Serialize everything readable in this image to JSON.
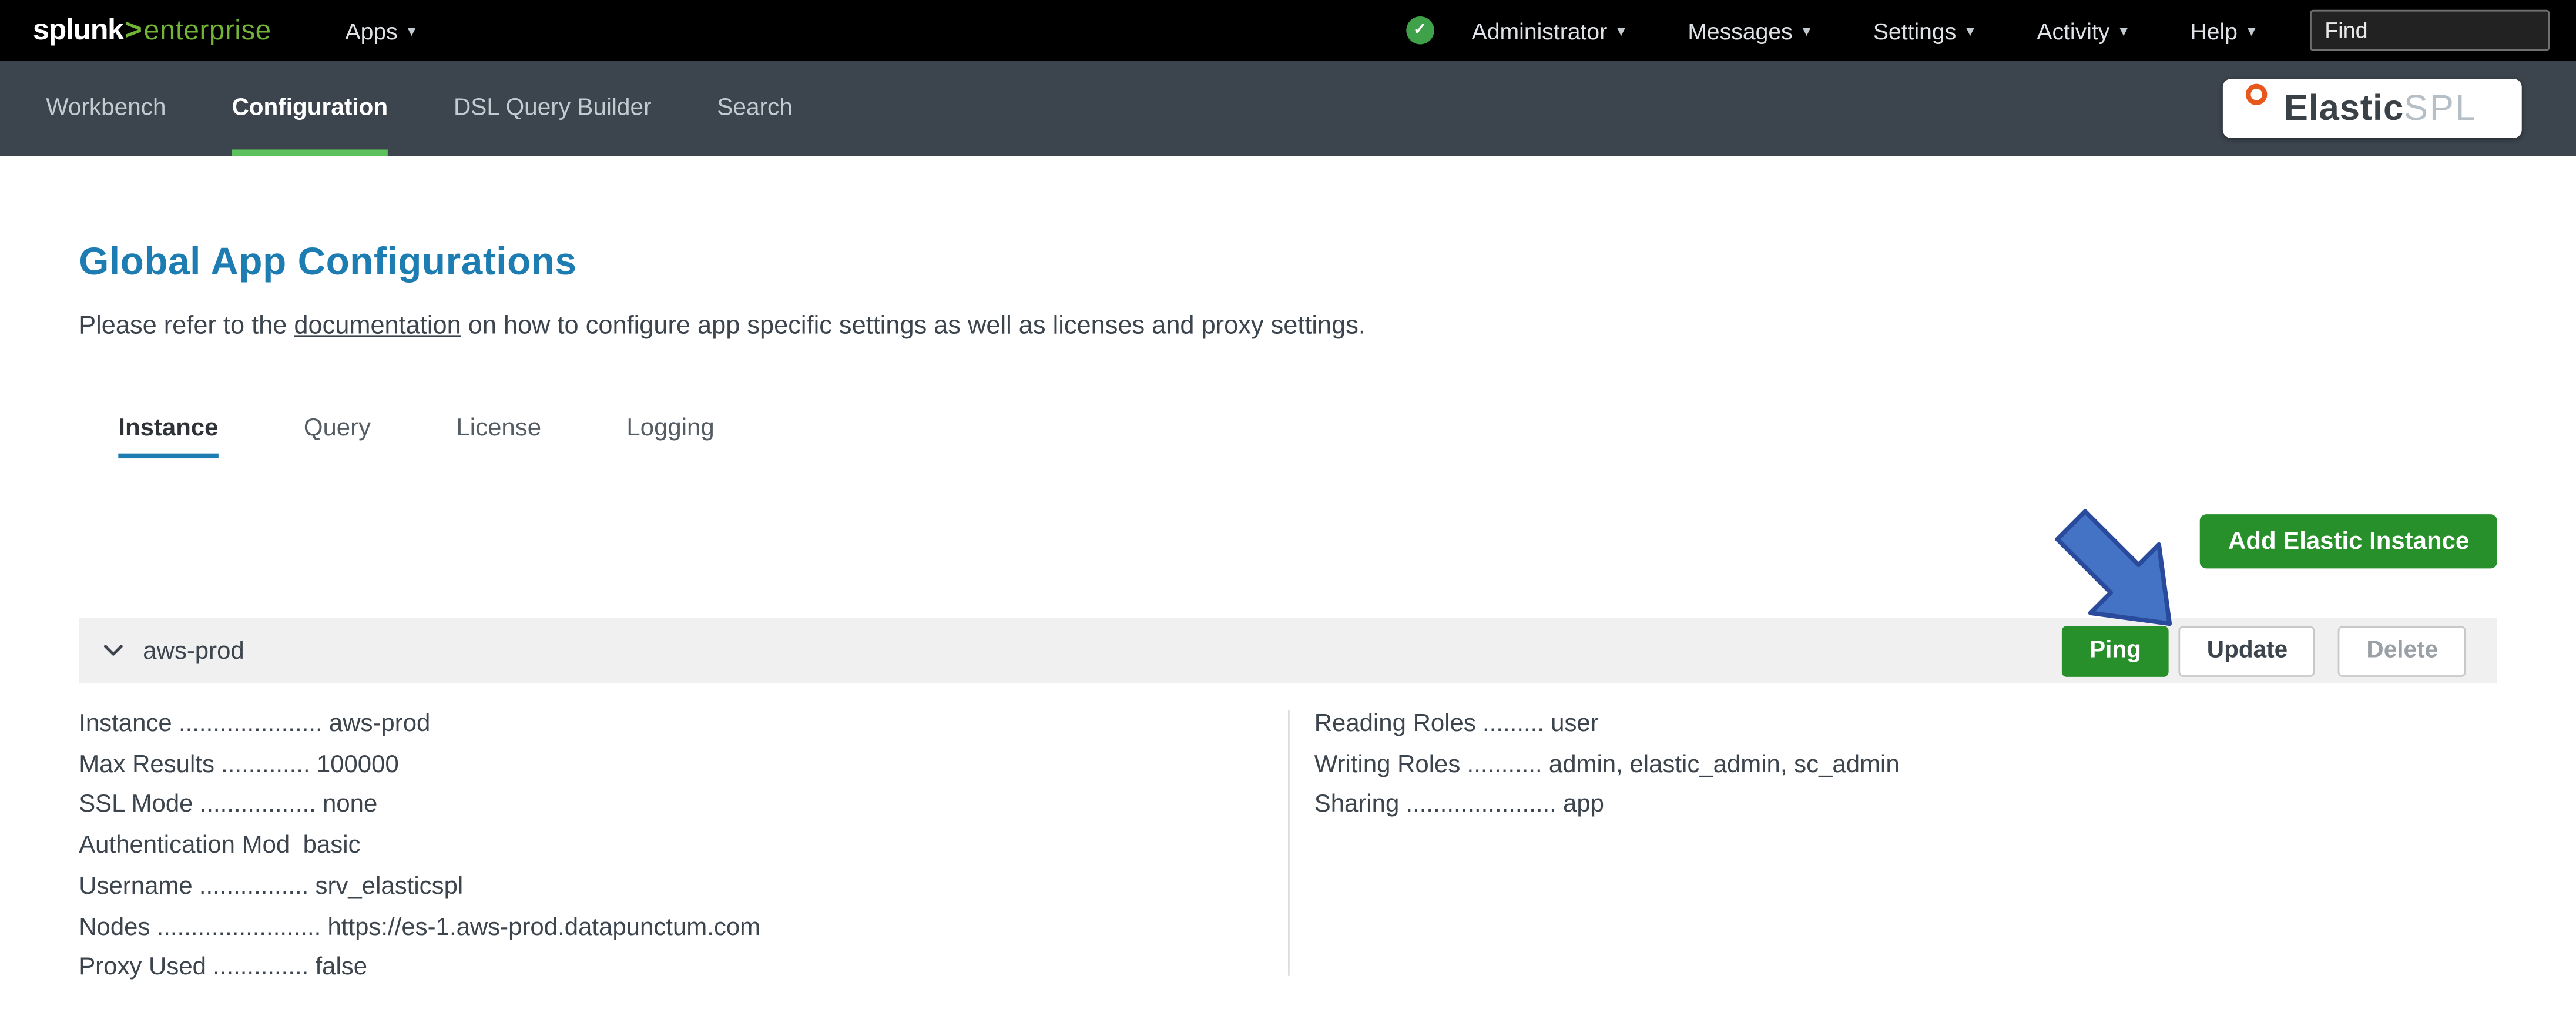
{
  "icons": {
    "caret_down": "▾",
    "check": "✓",
    "chevron_down": "⌄"
  },
  "colors": {
    "topbar_bg": "#000000",
    "appbar_bg": "#3c444d",
    "splunk_green": "#5cc05c",
    "title_blue": "#1d7db3",
    "button_green": "#28902b",
    "arrow_blue": "#4472c4",
    "panel_bg": "#f0f0f0",
    "elasticspl_orange": "#e8571c"
  },
  "topbar": {
    "logo": {
      "brand": "splunk",
      "gt": ">",
      "product": "enterprise"
    },
    "apps_label": "Apps",
    "menus": [
      "Administrator",
      "Messages",
      "Settings",
      "Activity",
      "Help"
    ],
    "find_placeholder": "Find"
  },
  "appbar": {
    "items": [
      "Workbench",
      "Configuration",
      "DSL Query Builder",
      "Search"
    ],
    "active_item": "Configuration",
    "logo": {
      "elastic": "Elastic",
      "spl": "SPL"
    }
  },
  "main": {
    "title": "Global App Configurations",
    "intro": {
      "before": "Please refer to the ",
      "link": "documentation",
      "after": " on how to configure app specific settings as well as licenses and proxy settings."
    },
    "tabs": [
      "Instance",
      "Query",
      "License",
      "Logging"
    ],
    "active_tab": "Instance",
    "add_button_label": "Add Elastic Instance",
    "instance_row": {
      "name": "aws-prod",
      "ping_label": "Ping",
      "update_label": "Update",
      "delete_label": "Delete"
    },
    "details": {
      "left": [
        {
          "label": "Instance",
          "dots": ".....................",
          "value": "aws-prod"
        },
        {
          "label": "Max Results",
          "dots": ".............",
          "value": "100000"
        },
        {
          "label": "SSL Mode",
          "dots": ".................",
          "value": "none"
        },
        {
          "label": "Authentication Mod",
          "dots": "",
          "value": "basic"
        },
        {
          "label": "Username",
          "dots": "................",
          "value": "srv_elasticspl"
        },
        {
          "label": "Nodes",
          "dots": "........................",
          "value": "https://es-1.aws-prod.datapunctum.com"
        },
        {
          "label": "Proxy Used",
          "dots": "..............",
          "value": "false"
        }
      ],
      "right": [
        {
          "label": "Reading Roles",
          "dots": ".........",
          "value": "user"
        },
        {
          "label": "Writing Roles",
          "dots": "...........",
          "value": "admin, elastic_admin, sc_admin"
        },
        {
          "label": "Sharing",
          "dots": "......................",
          "value": "app"
        }
      ]
    }
  }
}
